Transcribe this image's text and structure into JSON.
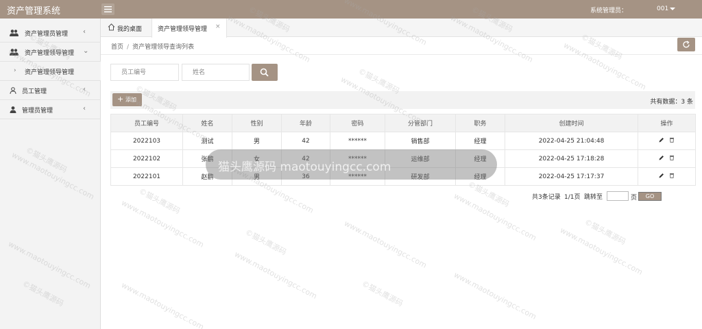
{
  "app": {
    "title": "资产管理系统",
    "user_role": "系统管理员：",
    "user_name": "001"
  },
  "sidebar": {
    "items": [
      {
        "label": "资产管理员管理",
        "icon": "users-icon",
        "arrow": "‹"
      },
      {
        "label": "资产管理领导管理",
        "icon": "users-icon",
        "arrow": "⌄"
      },
      {
        "label": "资产管理领导管理",
        "icon": "chevron-right-icon",
        "arrow": "›"
      },
      {
        "label": "员工管理",
        "icon": "user-outline-icon",
        "arrow": "‹"
      },
      {
        "label": "管理员管理",
        "icon": "user-icon",
        "arrow": "‹"
      }
    ]
  },
  "tabs": [
    {
      "label": "我的桌面"
    },
    {
      "label": "资产管理领导管理",
      "close": "×"
    }
  ],
  "breadcrumb": {
    "home": "首页",
    "sep": "/",
    "current": "资产管理领导查询列表"
  },
  "search": {
    "employee_id_placeholder": "员工编号",
    "name_placeholder": "姓名"
  },
  "toolbar": {
    "add_label": "添加",
    "total_text": "共有数据：3 条"
  },
  "table": {
    "columns": [
      "员工编号",
      "姓名",
      "性别",
      "年龄",
      "密码",
      "分管部门",
      "职务",
      "创建时间",
      "操作"
    ],
    "rows": [
      [
        "2022103",
        "测试",
        "男",
        "42",
        "******",
        "销售部",
        "经理",
        "2022-04-25 21:04:48"
      ],
      [
        "2022102",
        "张鹏",
        "女",
        "42",
        "******",
        "运维部",
        "经理",
        "2022-04-25 17:18:28"
      ],
      [
        "2022101",
        "赵鹏",
        "男",
        "36",
        "******",
        "研发部",
        "经理",
        "2022-04-25 17:17:37"
      ]
    ]
  },
  "pager": {
    "records": "共3条记录",
    "pages": "1/1页",
    "jump": "跳转至",
    "unit": "页",
    "go": "GO"
  },
  "watermark": {
    "url": "www.maotouyingcc.com",
    "cn": "©猫头鹰源码",
    "banner": "猫头鹰源码 maotouyingcc.com"
  },
  "colors": {
    "accent": "#a59384",
    "sidebar_bg": "#f3f3f3",
    "table_header_bg": "#f2f2f2"
  }
}
